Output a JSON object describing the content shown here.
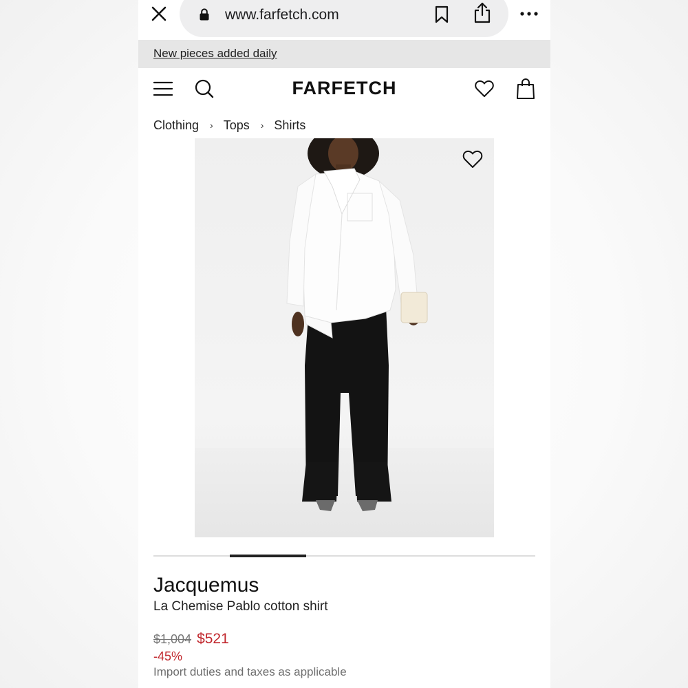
{
  "browser": {
    "url": "www.farfetch.com"
  },
  "promo": {
    "text": "New pieces added daily"
  },
  "header": {
    "logo": "FARFETCH"
  },
  "breadcrumb": {
    "items": [
      "Clothing",
      "Tops",
      "Shirts"
    ],
    "separator": "›"
  },
  "gallery": {
    "image_description": "product photo",
    "active_slide_index": 2,
    "slide_count": 5
  },
  "product": {
    "brand": "Jacquemus",
    "name": "La Chemise Pablo cotton shirt",
    "original_price": "$1,004",
    "sale_price": "$521",
    "discount": "-45%",
    "duties_note": "Import duties and taxes as applicable"
  },
  "colors": {
    "sale_red": "#c1272d",
    "banner_gray": "#e6e6e6",
    "url_bar_gray": "#eeeeef"
  },
  "icons": [
    "close-icon",
    "lock-icon",
    "bookmark-icon",
    "share-icon",
    "more-icon",
    "menu-icon",
    "search-icon",
    "heart-icon",
    "bag-icon"
  ]
}
